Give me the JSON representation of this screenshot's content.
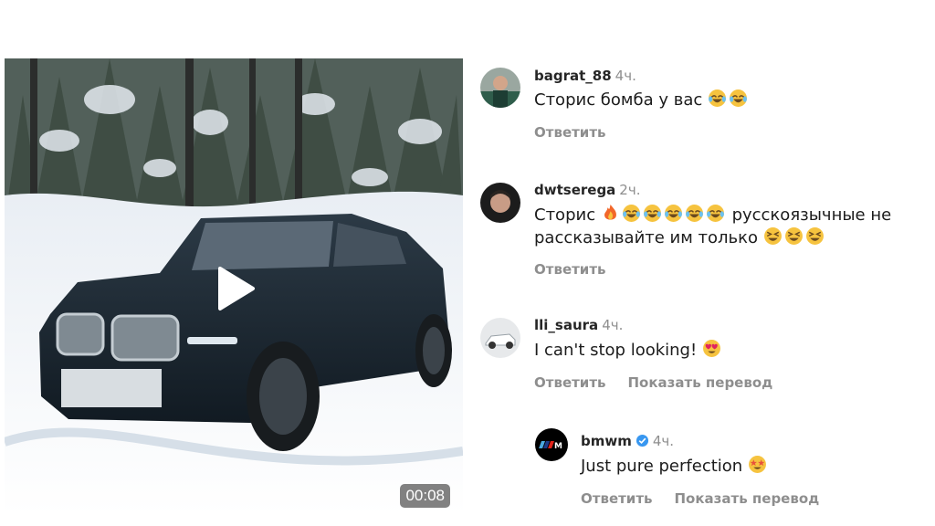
{
  "video": {
    "duration": "00:08",
    "play_icon": "play-icon"
  },
  "comments": [
    {
      "username": "bagrat_88",
      "time": "4ч.",
      "text_before_emoji": "Сторис бомба у вас",
      "emojis": [
        "laughing-crying-emoji",
        "laughing-crying-emoji"
      ],
      "reply_label": "Ответить"
    },
    {
      "username": "dwtserega",
      "time": "2ч.",
      "line1_prefix": "Сторис",
      "line1_emojis": [
        "fire-emoji",
        "laughing-crying-emoji",
        "laughing-crying-emoji",
        "laughing-crying-emoji",
        "laughing-crying-emoji",
        "laughing-crying-emoji"
      ],
      "line1_suffix": "русскоязычные не",
      "line2_prefix": "рассказывайте им только",
      "line2_emojis": [
        "grinning-squint-emoji",
        "grinning-squint-emoji",
        "grinning-squint-emoji"
      ],
      "reply_label": "Ответить"
    },
    {
      "username": "lli_saura",
      "time": "4ч.",
      "text": "I can't stop looking!",
      "emojis": [
        "heart-eyes-emoji"
      ],
      "reply_label": "Ответить",
      "translate_label": "Показать перевод"
    },
    {
      "username": "bmwm",
      "verified": true,
      "time": "4ч.",
      "text": "Just pure perfection",
      "emojis": [
        "star-struck-emoji"
      ],
      "reply_label": "Ответить",
      "translate_label": "Показать перевод"
    }
  ],
  "colors": {
    "text": "#262626",
    "muted": "#8e8e8e",
    "verified_blue": "#3897f0",
    "emoji_yellow": "#f6c33f"
  }
}
